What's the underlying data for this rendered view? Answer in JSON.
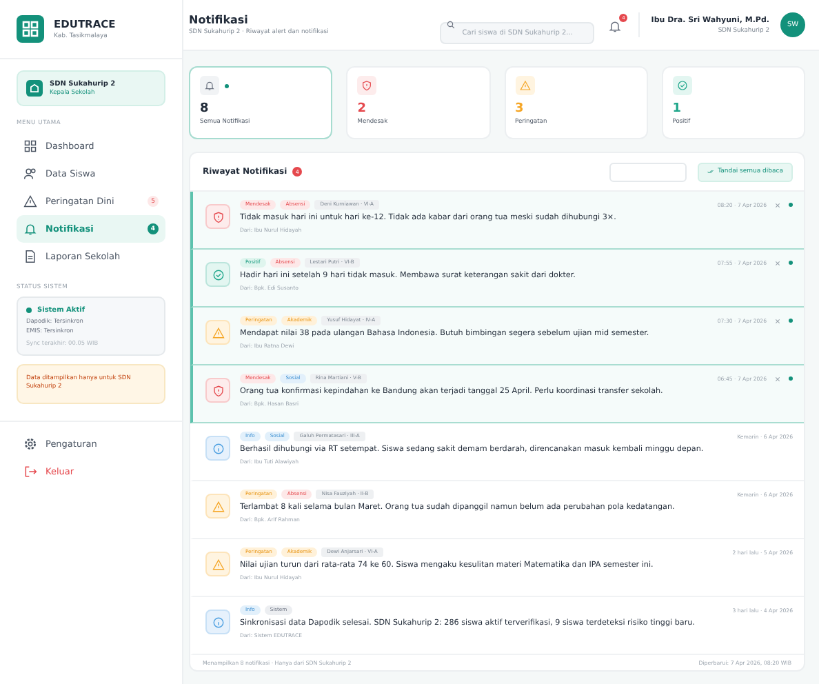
{
  "brand": {
    "name": "EDUTRACE",
    "region": "Kab. Tasikmalaya"
  },
  "school_card": {
    "name": "SDN Sukahurip 2",
    "role": "Kepala Sekolah"
  },
  "sidebar": {
    "section_main": "MENU UTAMA",
    "items": [
      {
        "label": "Dashboard",
        "kind": "grid",
        "selected": false
      },
      {
        "label": "Data Siswa",
        "kind": "users",
        "selected": false
      },
      {
        "label": "Peringatan Dini",
        "kind": "warning",
        "selected": false,
        "badge": "5"
      },
      {
        "label": "Notifikasi",
        "kind": "bell",
        "selected": true,
        "badge": "4"
      },
      {
        "label": "Laporan Sekolah",
        "kind": "doc",
        "selected": false
      }
    ],
    "section_status": "STATUS SISTEM",
    "status": {
      "title": "Sistem Aktif",
      "lines": [
        "Dapodik: Tersinkron",
        "EMIS: Tersinkron",
        "Sync terakhir: 00.05 WIB"
      ]
    },
    "notice": "Data ditampilkan hanya untuk SDN Sukahurip 2",
    "bottom_items": [
      {
        "label": "Pengaturan",
        "kind": "settings"
      },
      {
        "label": "Keluar",
        "kind": "logout"
      }
    ]
  },
  "header": {
    "title": "Notifikasi",
    "subtitle": "SDN Sukahurip 2 · Riwayat alert dan notifikasi",
    "search": {
      "placeholder": "Cari siswa di SDN Sukahurip 2..."
    },
    "bell_badge": "4",
    "user": {
      "name": "Ibu Dra. Sri Wahyuni, M.Pd.",
      "school": "SDN Sukahurip 2",
      "initials": "SW"
    }
  },
  "stats": [
    {
      "value": "8",
      "label": "Semua Notifikasi",
      "kind": "all",
      "selected": true
    },
    {
      "value": "2",
      "label": "Mendesak",
      "kind": "urgent",
      "selected": false
    },
    {
      "value": "3",
      "label": "Peringatan",
      "kind": "warning",
      "selected": false
    },
    {
      "value": "1",
      "label": "Positif",
      "kind": "positive",
      "selected": false
    }
  ],
  "panel": {
    "title": "Riwayat Notifikasi",
    "count": "4",
    "mark_all": "Tandai semua dibaca",
    "notifications": [
      {
        "kind": "urgent",
        "unread": true,
        "tags": [
          {
            "label": "Mendesak",
            "kind": "red"
          },
          {
            "label": "Absensi",
            "kind": "red"
          }
        ],
        "student": "Deni Kurniawan · VI-A",
        "time": "08:20 · 7 Apr 2026",
        "message": "Tidak masuk hari ini untuk hari ke-12. Tidak ada kabar dari orang tua meski sudah dihubungi 3×.",
        "from": "Dari: Ibu Nurul Hidayah"
      },
      {
        "kind": "positive",
        "unread": true,
        "tags": [
          {
            "label": "Positif",
            "kind": "green"
          },
          {
            "label": "Absensi",
            "kind": "red"
          }
        ],
        "student": "Lestari Putri · VI-B",
        "time": "07:55 · 7 Apr 2026",
        "message": "Hadir hari ini setelah 9 hari tidak masuk. Membawa surat keterangan sakit dari dokter.",
        "from": "Dari: Bpk. Edi Susanto"
      },
      {
        "kind": "warning",
        "unread": true,
        "tags": [
          {
            "label": "Peringatan",
            "kind": "orange"
          },
          {
            "label": "Akademik",
            "kind": "orange"
          }
        ],
        "student": "Yusuf Hidayat · IV-A",
        "time": "07:30 · 7 Apr 2026",
        "message": "Mendapat nilai 38 pada ulangan Bahasa Indonesia. Butuh bimbingan segera sebelum ujian mid semester.",
        "from": "Dari: Ibu Ratna Dewi"
      },
      {
        "kind": "urgent",
        "unread": true,
        "tags": [
          {
            "label": "Mendesak",
            "kind": "red"
          },
          {
            "label": "Sosial",
            "kind": "blue"
          }
        ],
        "student": "Rina Martiani · V-B",
        "time": "06:45 · 7 Apr 2026",
        "message": "Orang tua konfirmasi kepindahan ke Bandung akan terjadi tanggal 25 April. Perlu koordinasi transfer sekolah.",
        "from": "Dari: Bpk. Hasan Basri"
      },
      {
        "kind": "info",
        "unread": false,
        "tags": [
          {
            "label": "Info",
            "kind": "blue"
          },
          {
            "label": "Sosial",
            "kind": "blue"
          }
        ],
        "student": "Galuh Permatasari · III-A",
        "time": "Kemarin · 6 Apr 2026",
        "message": "Berhasil dihubungi via RT setempat. Siswa sedang sakit demam berdarah, direncanakan masuk kembali minggu depan.",
        "from": "Dari: Ibu Tuti Alawiyah"
      },
      {
        "kind": "warning",
        "unread": false,
        "tags": [
          {
            "label": "Peringatan",
            "kind": "orange"
          },
          {
            "label": "Absensi",
            "kind": "red"
          }
        ],
        "student": "Nisa Fauziyah · II-B",
        "time": "Kemarin · 6 Apr 2026",
        "message": "Terlambat 8 kali selama bulan Maret. Orang tua sudah dipanggil namun belum ada perubahan pola kedatangan.",
        "from": "Dari: Bpk. Arif Rahman"
      },
      {
        "kind": "warning",
        "unread": false,
        "tags": [
          {
            "label": "Peringatan",
            "kind": "orange"
          },
          {
            "label": "Akademik",
            "kind": "orange"
          }
        ],
        "student": "Dewi Anjarsari · VI-A",
        "time": "2 hari lalu · 5 Apr 2026",
        "message": "Nilai ujian turun dari rata-rata 74 ke 60. Siswa mengaku kesulitan materi Matematika dan IPA semester ini.",
        "from": "Dari: Ibu Nurul Hidayah"
      },
      {
        "kind": "info",
        "unread": false,
        "tags": [
          {
            "label": "Info",
            "kind": "blue"
          },
          {
            "label": "Sistem",
            "kind": "grey"
          }
        ],
        "time": "3 hari lalu · 4 Apr 2026",
        "message": "Sinkronisasi data Dapodik selesai. SDN Sukahurip 2: 286 siswa aktif terverifikasi, 9 siswa terdeteksi risiko tinggi baru.",
        "from": "Dari: Sistem EDUTRACE"
      }
    ],
    "footer_left": "Menampilkan 8 notifikasi · Hanya dari SDN Sukahurip 2",
    "footer_right": "Diperbarui: 7 Apr 2026, 08:20 WIB"
  }
}
